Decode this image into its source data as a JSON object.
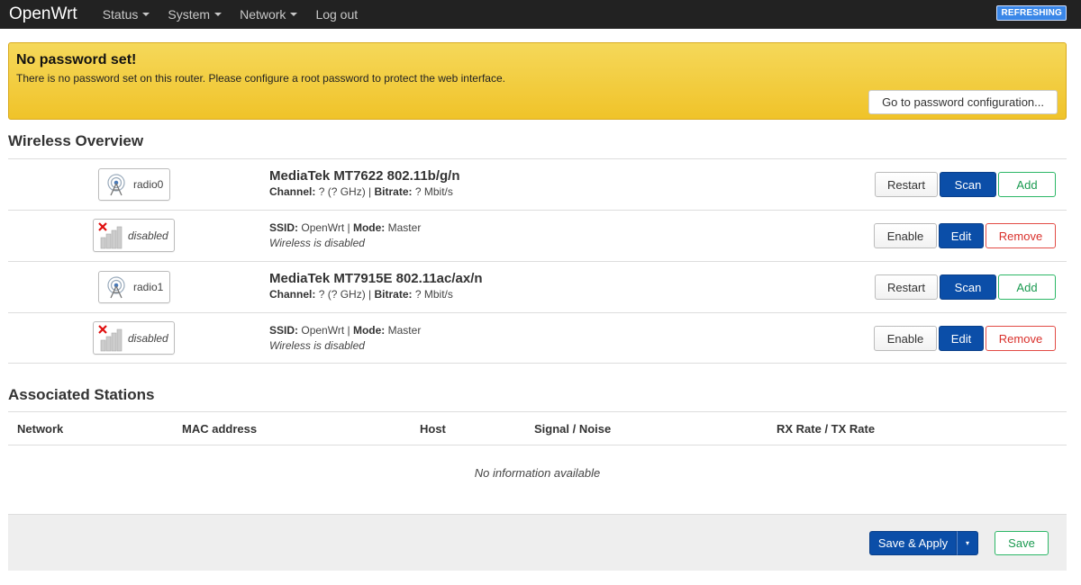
{
  "nav": {
    "brand": "OpenWrt",
    "items": [
      {
        "label": "Status",
        "dropdown": true
      },
      {
        "label": "System",
        "dropdown": true
      },
      {
        "label": "Network",
        "dropdown": true
      },
      {
        "label": "Log out",
        "dropdown": false
      }
    ],
    "refresh_badge": "REFRESHING"
  },
  "alert": {
    "title": "No password set!",
    "text": "There is no password set on this router. Please configure a root password to protect the web interface.",
    "button": "Go to password configuration..."
  },
  "wireless": {
    "heading": "Wireless Overview",
    "rows": [
      {
        "kind": "device",
        "badge_label": "radio0",
        "title": "MediaTek MT7622 802.11b/g/n",
        "channel_label": "Channel:",
        "channel_value": "? (? GHz)",
        "sep": "|",
        "bitrate_label": "Bitrate:",
        "bitrate_value": "? Mbit/s",
        "buttons": [
          "Restart",
          "Scan",
          "Add"
        ]
      },
      {
        "kind": "iface",
        "badge_label": "disabled",
        "ssid_label": "SSID:",
        "ssid_value": "OpenWrt",
        "sep": "|",
        "mode_label": "Mode:",
        "mode_value": "Master",
        "status": "Wireless is disabled",
        "buttons": [
          "Enable",
          "Edit",
          "Remove"
        ]
      },
      {
        "kind": "device",
        "badge_label": "radio1",
        "title": "MediaTek MT7915E 802.11ac/ax/n",
        "channel_label": "Channel:",
        "channel_value": "? (? GHz)",
        "sep": "|",
        "bitrate_label": "Bitrate:",
        "bitrate_value": "? Mbit/s",
        "buttons": [
          "Restart",
          "Scan",
          "Add"
        ]
      },
      {
        "kind": "iface",
        "badge_label": "disabled",
        "ssid_label": "SSID:",
        "ssid_value": "OpenWrt",
        "sep": "|",
        "mode_label": "Mode:",
        "mode_value": "Master",
        "status": "Wireless is disabled",
        "buttons": [
          "Enable",
          "Edit",
          "Remove"
        ]
      }
    ]
  },
  "stations": {
    "heading": "Associated Stations",
    "columns": [
      "Network",
      "MAC address",
      "Host",
      "Signal / Noise",
      "RX Rate / TX Rate"
    ],
    "empty": "No information available"
  },
  "footer": {
    "save_apply": "Save & Apply",
    "save_apply_dropdown": "▾",
    "save": "Save"
  },
  "colors": {
    "topbar": "#222222",
    "alert": "#f0c329",
    "primary": "#0b4ea8",
    "positive": "#1a9a50",
    "negative": "#d9302b"
  }
}
